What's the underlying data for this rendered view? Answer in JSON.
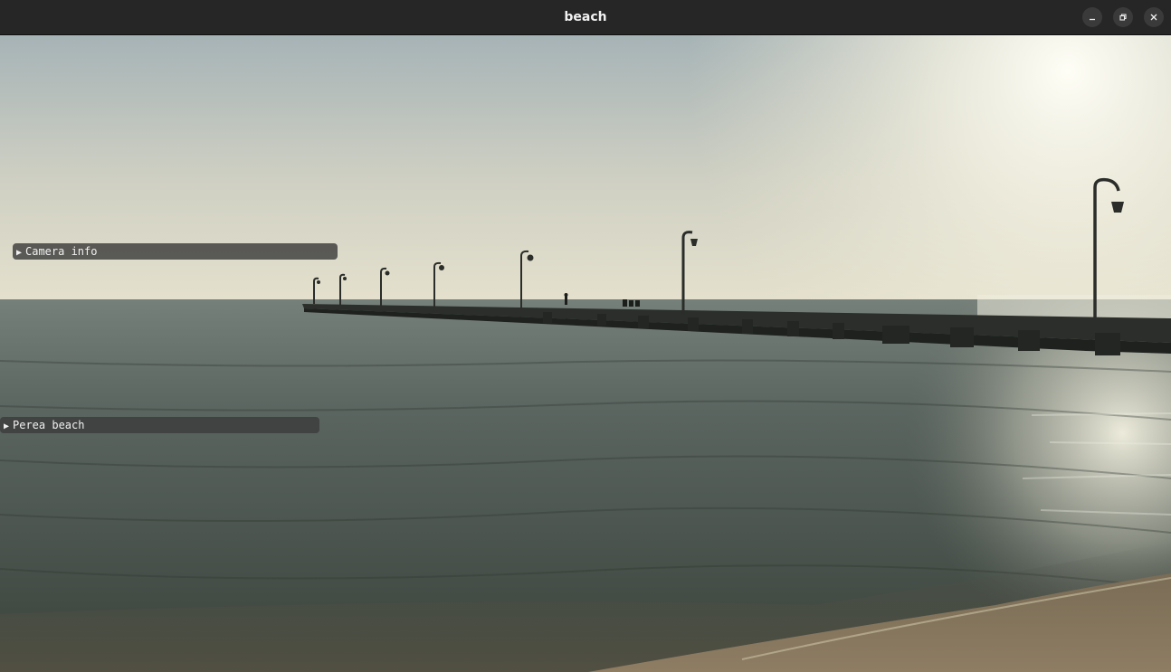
{
  "window": {
    "title": "beach",
    "controls": {
      "minimize_icon": "minimize-icon",
      "restore_icon": "restore-icon",
      "close_icon": "close-icon"
    }
  },
  "overlays": {
    "camera_info": {
      "label": "Camera info",
      "arrow": "▶",
      "expanded": false
    },
    "perea_beach": {
      "label": "Perea beach",
      "arrow": "▶",
      "expanded": false
    }
  },
  "scene": {
    "subject": "pier at sunset over calm sea",
    "colors": {
      "sky_top": "#a9b4b6",
      "sky_horizon": "#e6e2cf",
      "sun_glow": "#fffdf2",
      "sea_far": "#6c7570",
      "sea_near": "#3e463f",
      "pier": "#2a2d29",
      "sand": "#8a7a62"
    }
  }
}
